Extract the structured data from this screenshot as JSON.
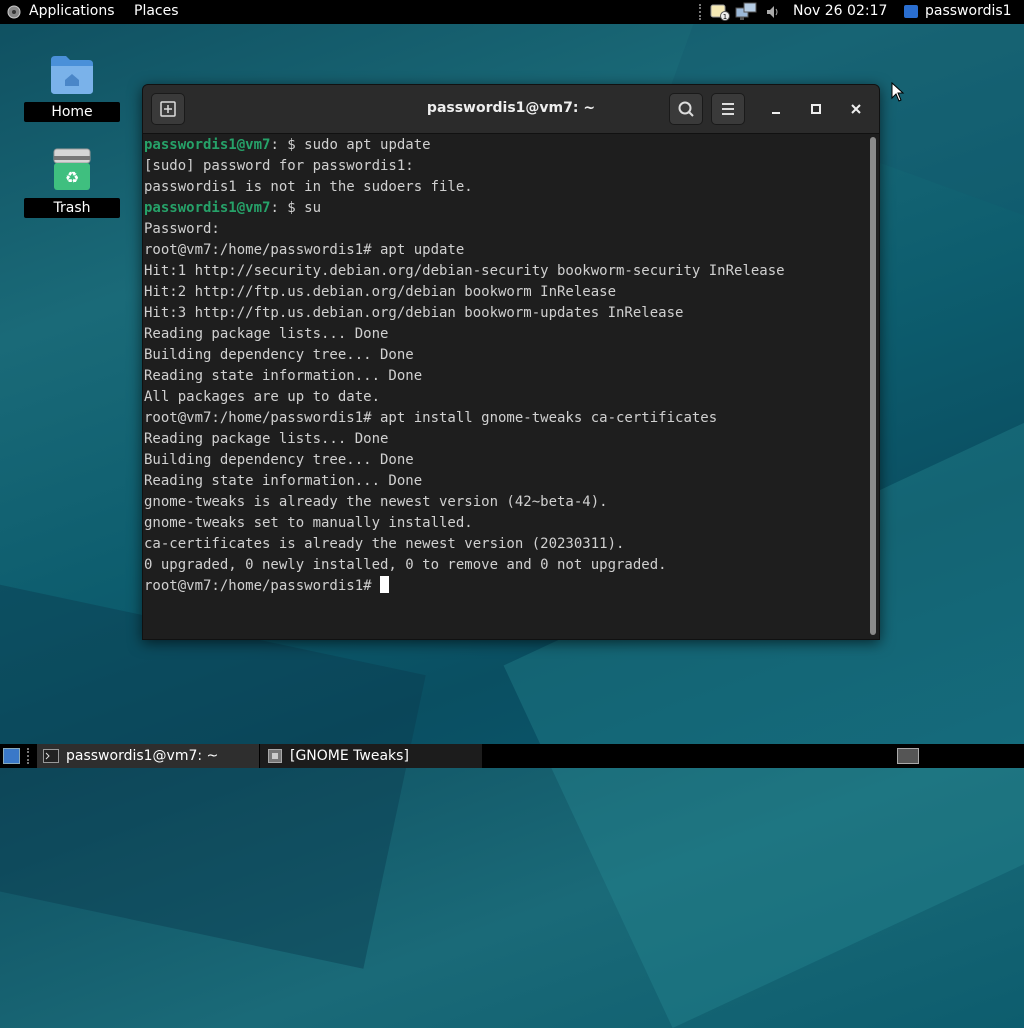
{
  "topbar": {
    "applications": "Applications",
    "places": "Places",
    "datetime": "Nov 26  02:17",
    "user": "passwordis1"
  },
  "desktop": {
    "icons": [
      {
        "label": "Home",
        "icon": "folder-home-icon"
      },
      {
        "label": "Trash",
        "icon": "trash-icon"
      }
    ]
  },
  "terminal": {
    "title": "passwordis1@vm7: ~",
    "lines": [
      {
        "prompt": "passwordis1@vm7",
        "rest": ": $ sudo apt update"
      },
      {
        "text": "[sudo] password for passwordis1:"
      },
      {
        "text": "passwordis1 is not in the sudoers file."
      },
      {
        "prompt": "passwordis1@vm7",
        "rest": ": $ su"
      },
      {
        "text": "Password:"
      },
      {
        "text": "root@vm7:/home/passwordis1# apt update"
      },
      {
        "text": "Hit:1 http://security.debian.org/debian-security bookworm-security InRelease"
      },
      {
        "text": "Hit:2 http://ftp.us.debian.org/debian bookworm InRelease"
      },
      {
        "text": "Hit:3 http://ftp.us.debian.org/debian bookworm-updates InRelease"
      },
      {
        "text": "Reading package lists... Done"
      },
      {
        "text": "Building dependency tree... Done"
      },
      {
        "text": "Reading state information... Done"
      },
      {
        "text": "All packages are up to date."
      },
      {
        "text": "root@vm7:/home/passwordis1# apt install gnome-tweaks ca-certificates"
      },
      {
        "text": "Reading package lists... Done"
      },
      {
        "text": "Building dependency tree... Done"
      },
      {
        "text": "Reading state information... Done"
      },
      {
        "text": "gnome-tweaks is already the newest version (42~beta-4)."
      },
      {
        "text": "gnome-tweaks set to manually installed."
      },
      {
        "text": "ca-certificates is already the newest version (20230311)."
      },
      {
        "text": "0 upgraded, 0 newly installed, 0 to remove and 0 not upgraded."
      }
    ],
    "current_prompt": "root@vm7:/home/passwordis1# "
  },
  "taskbar": {
    "tasks": [
      {
        "label": "passwordis1@vm7: ~",
        "icon": "terminal-icon",
        "active": true
      },
      {
        "label": "[GNOME Tweaks]",
        "icon": "tweaks-icon",
        "active": false
      }
    ]
  },
  "colors": {
    "prompt_user": "#26a269",
    "terminal_bg": "#1e1e1e",
    "header_bg": "#2b2b2b"
  }
}
